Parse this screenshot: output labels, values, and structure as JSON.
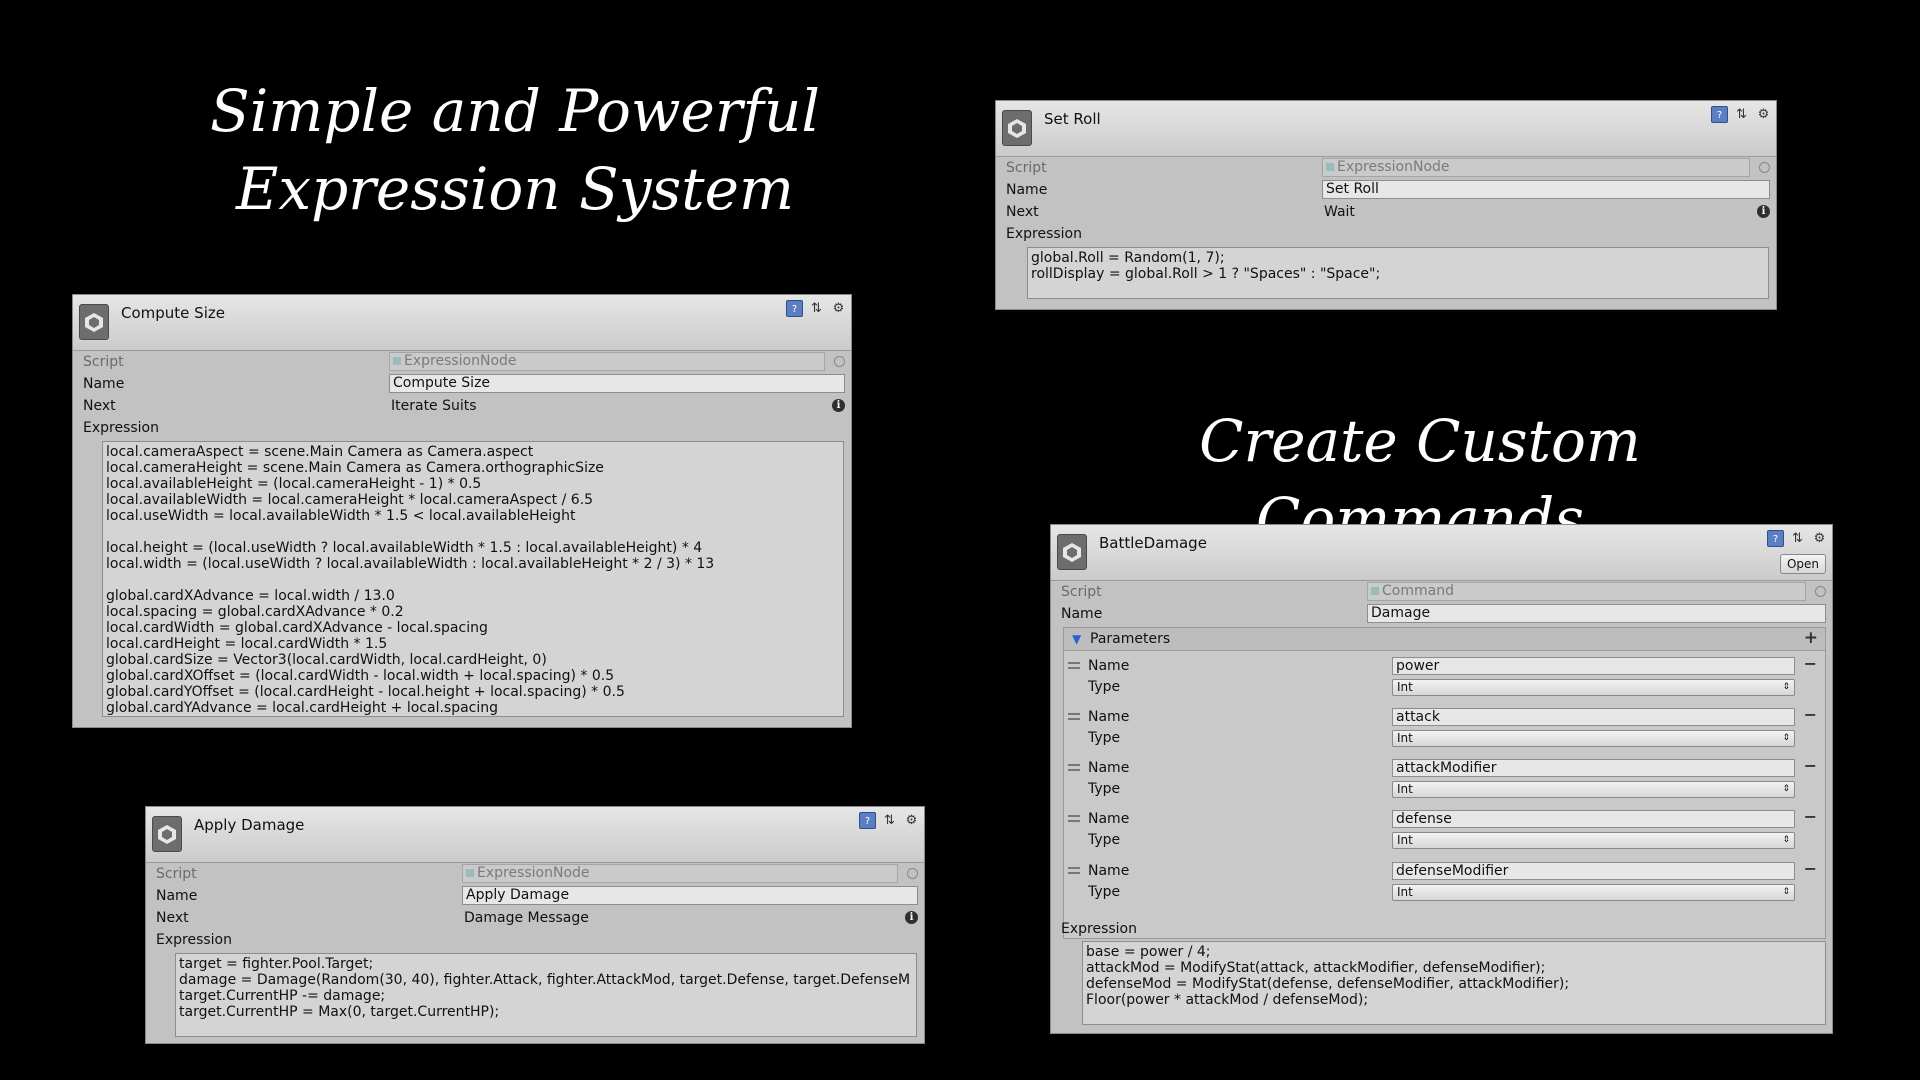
{
  "headlines": {
    "left": "Simple and Powerful Expression System",
    "right": "Create Custom Commands"
  },
  "icons": {
    "logo": "unity-logo-icon",
    "help": "book-help-icon",
    "presets": "sliders-icon",
    "settings": "gear-icon",
    "info": "info-icon",
    "target": "object-picker-icon"
  },
  "labels": {
    "script": "Script",
    "name": "Name",
    "next": "Next",
    "expression": "Expression",
    "type": "Type"
  },
  "panels": {
    "set_roll": {
      "title": "Set Roll",
      "script": "ExpressionNode",
      "name": "Set Roll",
      "next": "Wait",
      "expression": "global.Roll = Random(1, 7);\nrollDisplay = global.Roll > 1 ? \"Spaces\" : \"Space\";"
    },
    "compute_size": {
      "title": "Compute Size",
      "script": "ExpressionNode",
      "name": "Compute Size",
      "next": "Iterate Suits",
      "expression": "local.cameraAspect = scene.Main Camera as Camera.aspect\nlocal.cameraHeight = scene.Main Camera as Camera.orthographicSize\nlocal.availableHeight = (local.cameraHeight - 1) * 0.5\nlocal.availableWidth = local.cameraHeight * local.cameraAspect / 6.5\nlocal.useWidth = local.availableWidth * 1.5 < local.availableHeight\n\nlocal.height = (local.useWidth ? local.availableWidth * 1.5 : local.availableHeight) * 4\nlocal.width = (local.useWidth ? local.availableWidth : local.availableHeight * 2 / 3) * 13\n\nglobal.cardXAdvance = local.width / 13.0\nlocal.spacing = global.cardXAdvance * 0.2\nlocal.cardWidth = global.cardXAdvance - local.spacing\nlocal.cardHeight = local.cardWidth * 1.5\nglobal.cardSize = Vector3(local.cardWidth, local.cardHeight, 0)\nglobal.cardXOffset = (local.cardWidth - local.width + local.spacing) * 0.5\nglobal.cardYOffset = (local.cardHeight - local.height + local.spacing) * 0.5\nglobal.cardYAdvance = local.cardHeight + local.spacing"
    },
    "apply_damage": {
      "title": "Apply Damage",
      "script": "ExpressionNode",
      "name": "Apply Damage",
      "next": "Damage Message",
      "expression": "target = fighter.Pool.Target;\ndamage = Damage(Random(30, 40), fighter.Attack, fighter.AttackMod, target.Defense, target.DefenseM\ntarget.CurrentHP -= damage;\ntarget.CurrentHP = Max(0, target.CurrentHP);"
    },
    "battle_damage": {
      "title": "BattleDamage",
      "open_label": "Open",
      "script": "Command",
      "name": "Damage",
      "parameters_label": "Parameters",
      "parameters": [
        {
          "name": "power",
          "type": "Int"
        },
        {
          "name": "attack",
          "type": "Int"
        },
        {
          "name": "attackModifier",
          "type": "Int"
        },
        {
          "name": "defense",
          "type": "Int"
        },
        {
          "name": "defenseModifier",
          "type": "Int"
        }
      ],
      "expression": "base = power / 4;\nattackMod = ModifyStat(attack, attackModifier, defenseModifier);\ndefenseMod = ModifyStat(defense, defenseModifier, attackModifier);\nFloor(power * attackMod / defenseMod);"
    }
  }
}
